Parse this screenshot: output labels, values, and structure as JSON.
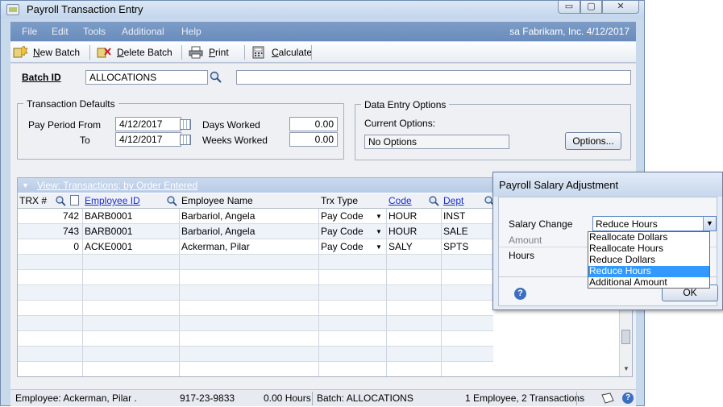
{
  "window": {
    "title": "Payroll Transaction Entry",
    "min_glyph": "▭",
    "max_glyph": "▢",
    "close_glyph": "✕"
  },
  "menu": {
    "items": [
      "File",
      "Edit",
      "Tools",
      "Additional",
      "Help"
    ],
    "company": "sa  Fabrikam, Inc.  4/12/2017"
  },
  "toolbar": {
    "new_batch": "New Batch",
    "delete_batch": "Delete Batch",
    "print": "Print",
    "calculate": "Calculate"
  },
  "batch": {
    "label": "Batch ID",
    "value": "ALLOCATIONS",
    "description": ""
  },
  "transaction_defaults": {
    "title": "Transaction Defaults",
    "pay_period_from_label": "Pay Period From",
    "pay_period_from": "4/12/2017",
    "to_label": "To",
    "to": "4/12/2017",
    "days_worked_label": "Days Worked",
    "days_worked": "0.00",
    "weeks_worked_label": "Weeks Worked",
    "weeks_worked": "0.00"
  },
  "data_entry": {
    "title": "Data Entry Options",
    "current_label": "Current Options:",
    "current_value": "No Options",
    "options_button": "Options..."
  },
  "grid": {
    "view_label": "View: Transactions; by Order Entered",
    "columns": [
      "TRX #",
      "Employee ID",
      "Employee Name",
      "Trx Type",
      "Code",
      "Dept"
    ],
    "rows": [
      {
        "trx": "742",
        "emp_id": "BARB0001",
        "name": "Barbariol, Angela",
        "type": "Pay Code",
        "code": "HOUR",
        "dept": "INST"
      },
      {
        "trx": "743",
        "emp_id": "BARB0001",
        "name": "Barbariol, Angela",
        "type": "Pay Code",
        "code": "HOUR",
        "dept": "SALE"
      },
      {
        "trx": "0",
        "emp_id": "ACKE0001",
        "name": "Ackerman, Pilar",
        "type": "Pay Code",
        "code": "SALY",
        "dept": "SPTS"
      }
    ]
  },
  "status": {
    "employee": "Employee: Ackerman, Pilar .",
    "ssn": "917-23-9833",
    "hours": "0.00 Hours",
    "batch": "Batch: ALLOCATIONS",
    "summary": "1 Employee, 2 Transactions"
  },
  "dialog": {
    "title": "Payroll Salary Adjustment",
    "salary_change_label": "Salary Change",
    "salary_change_value": "Reduce Hours",
    "amount_label": "Amount",
    "hours_label": "Hours",
    "ok_label": "OK",
    "options": [
      "Reallocate Dollars",
      "Reallocate Hours",
      "Reduce Dollars",
      "Reduce Hours",
      "Additional Amount"
    ],
    "selected_index": 3
  },
  "colors": {
    "menubar": "#7393c3",
    "link": "#1b2fd1",
    "selection": "#3399ff"
  }
}
